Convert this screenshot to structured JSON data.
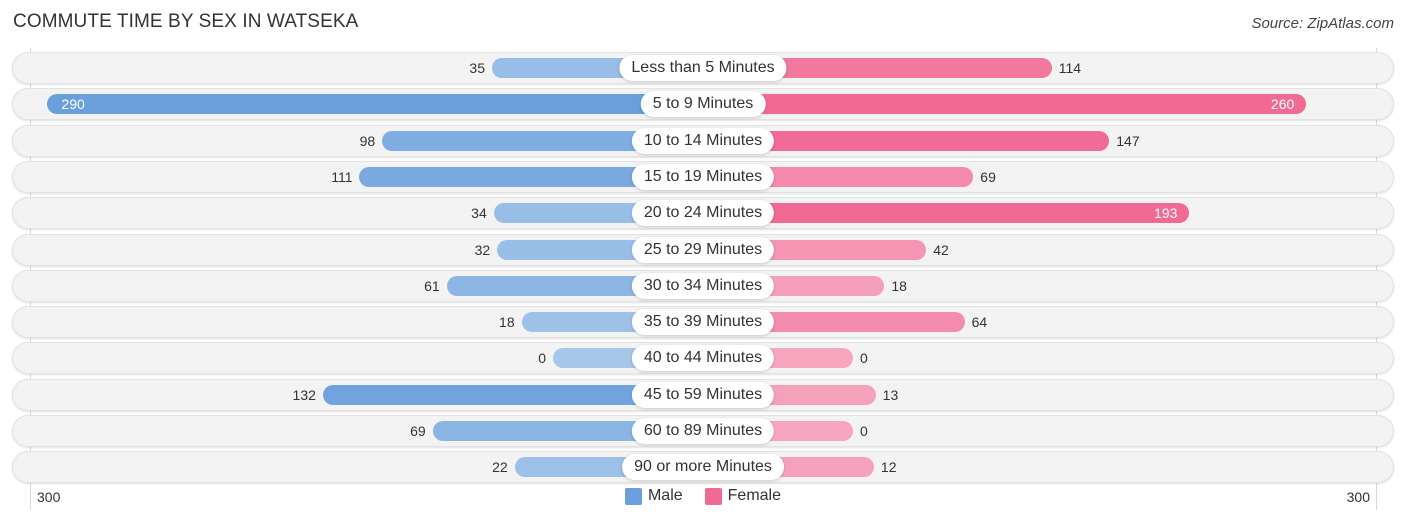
{
  "header": {
    "title": "COMMUTE TIME BY SEX IN WATSEKA",
    "source": "Source: ZipAtlas.com"
  },
  "colors": {
    "male_dark": "#6a9fdc",
    "male_light": "#a6c6ea",
    "female_dark": "#f06a94",
    "female_light": "#f7a6bf"
  },
  "chart_data": {
    "type": "bar",
    "orientation": "horizontal-diverging",
    "title": "COMMUTE TIME BY SEX IN WATSEKA",
    "categories": [
      "Less than 5 Minutes",
      "5 to 9 Minutes",
      "10 to 14 Minutes",
      "15 to 19 Minutes",
      "20 to 24 Minutes",
      "25 to 29 Minutes",
      "30 to 34 Minutes",
      "35 to 39 Minutes",
      "40 to 44 Minutes",
      "45 to 59 Minutes",
      "60 to 89 Minutes",
      "90 or more Minutes"
    ],
    "series": [
      {
        "name": "Male",
        "values": [
          35,
          290,
          98,
          111,
          34,
          32,
          61,
          18,
          0,
          132,
          69,
          22
        ]
      },
      {
        "name": "Female",
        "values": [
          114,
          260,
          147,
          69,
          193,
          42,
          18,
          64,
          0,
          13,
          0,
          12
        ]
      }
    ],
    "axis": {
      "left_tick": "300",
      "right_tick": "300",
      "max": 300
    },
    "legend": {
      "position": "bottom-center",
      "items": [
        "Male",
        "Female"
      ]
    },
    "grid": false
  }
}
